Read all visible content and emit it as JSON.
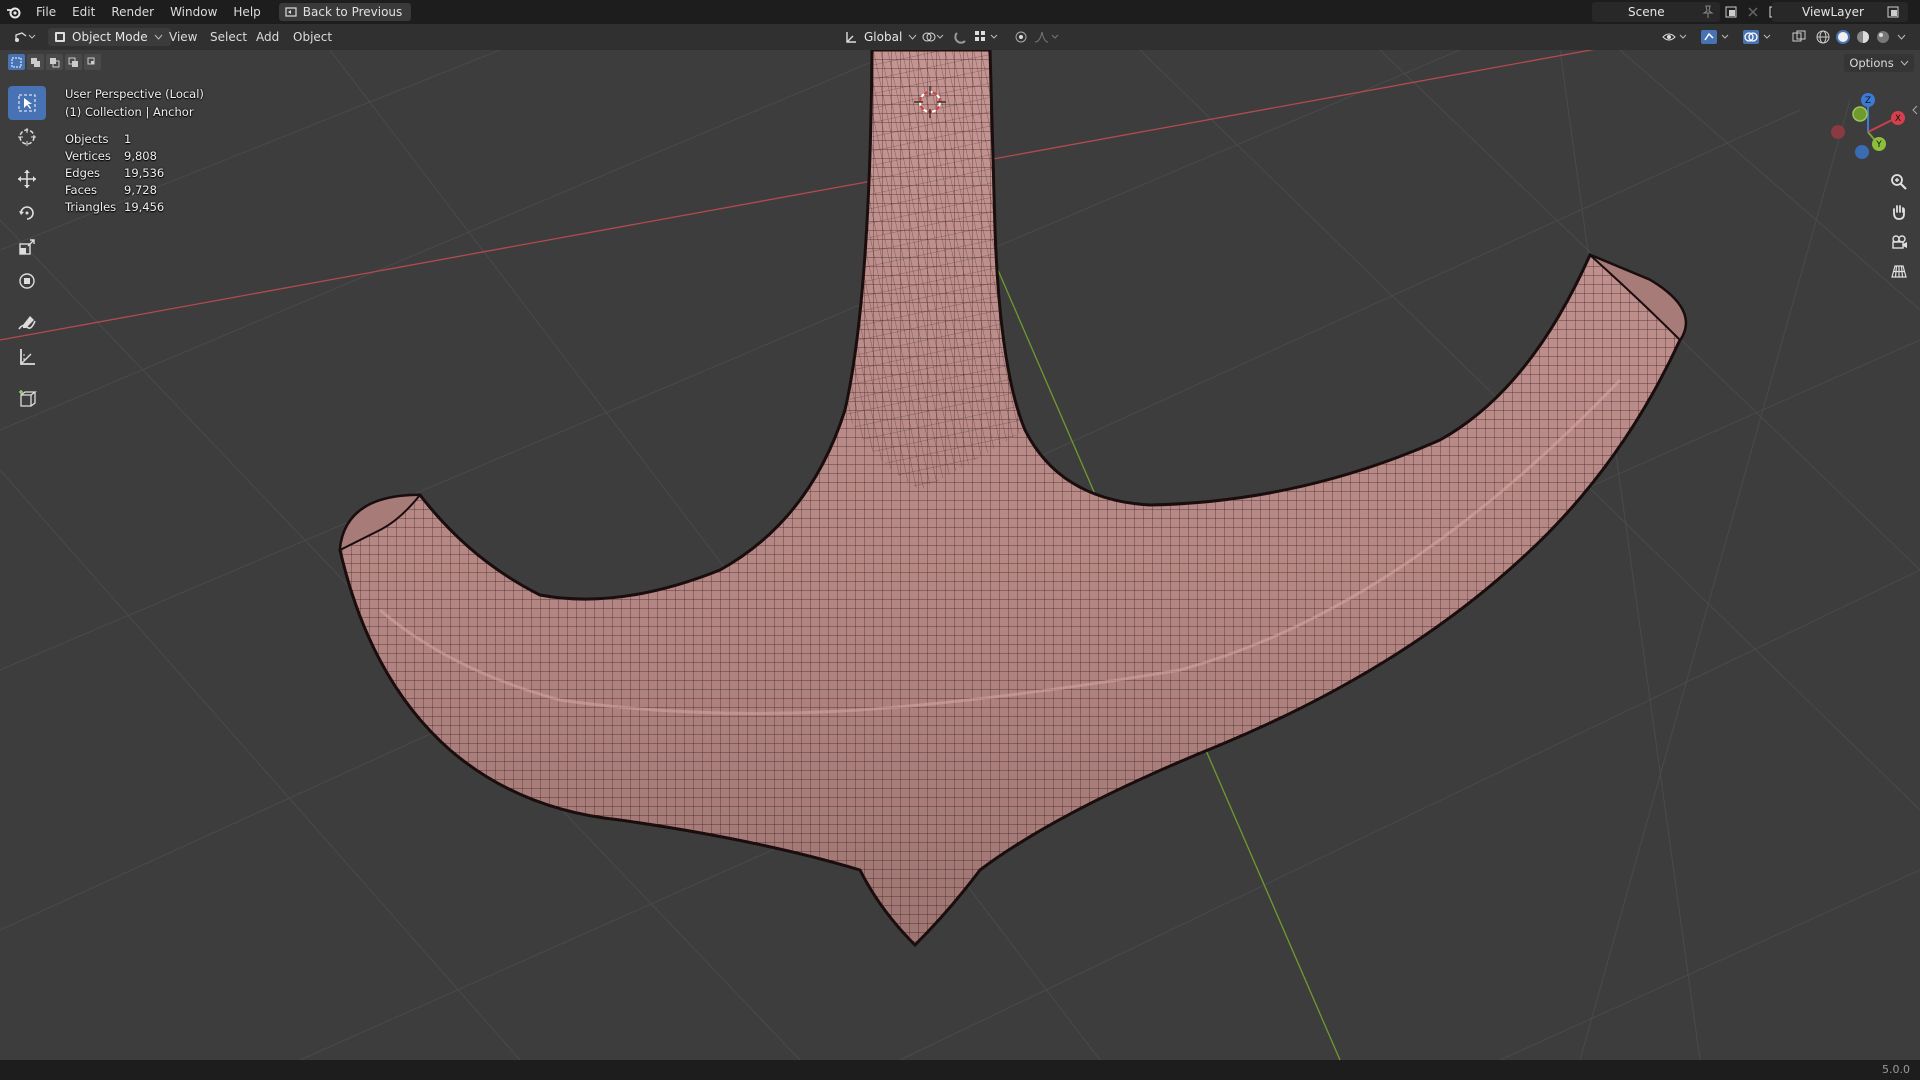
{
  "menu": {
    "items": [
      "File",
      "Edit",
      "Render",
      "Window",
      "Help"
    ],
    "back_label": "Back to Previous"
  },
  "topright": {
    "scene": "Scene",
    "view_layer": "ViewLayer"
  },
  "header": {
    "mode": "Object Mode",
    "view": "View",
    "select": "Select",
    "add": "Add",
    "object": "Object",
    "orientation": "Global"
  },
  "overlay": {
    "perspective": "User Perspective (Local)",
    "collection": "(1) Collection | Anchor"
  },
  "stats": [
    {
      "label": "Objects",
      "value": "1"
    },
    {
      "label": "Vertices",
      "value": "9,808"
    },
    {
      "label": "Edges",
      "value": "19,536"
    },
    {
      "label": "Faces",
      "value": "9,728"
    },
    {
      "label": "Triangles",
      "value": "19,456"
    }
  ],
  "options_label": "Options",
  "gizmo": {
    "x": "X",
    "y": "Y",
    "z": "Z"
  },
  "version": "5.0.0",
  "colors": {
    "mesh": "#b98a87",
    "wire": "#1a1010",
    "grid": "#4a4a4a",
    "x_axis": "#b34a4f",
    "y_axis": "#6f9a2e",
    "accent": "#4772b3"
  },
  "icons": {
    "blender": "blender-logo-icon",
    "editor_type": "editor-type-icon",
    "tools": [
      "select-box-icon",
      "cursor-icon",
      "move-icon",
      "rotate-icon",
      "scale-icon",
      "transform-icon",
      "annotate-icon",
      "measure-icon",
      "add-cube-icon"
    ]
  }
}
